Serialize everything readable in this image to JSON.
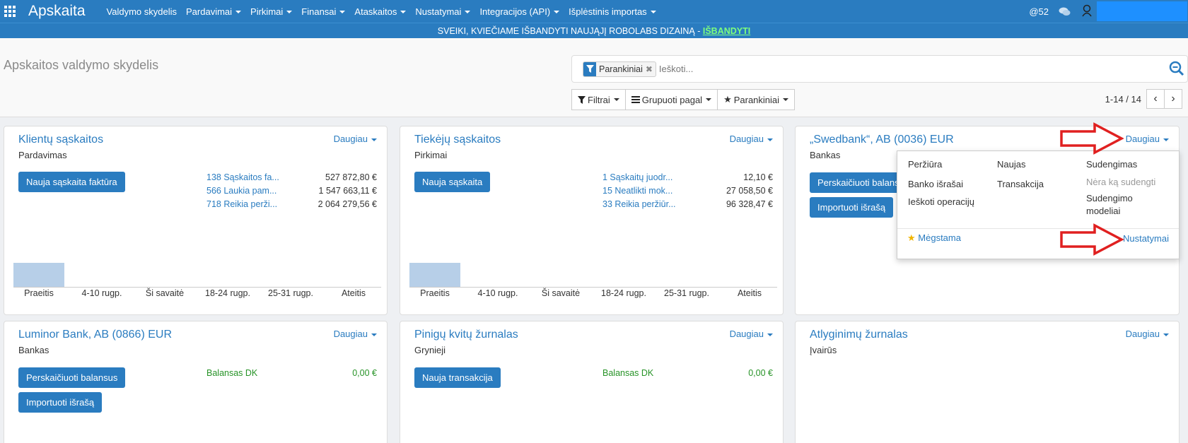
{
  "app": {
    "brand": "Apskaita"
  },
  "menu": [
    "Valdymo skydelis",
    "Pardavimai",
    "Pirkimai",
    "Finansai",
    "Ataskaitos",
    "Nustatymai",
    "Integracijos (API)",
    "Išplėstinis importas"
  ],
  "menu_has_caret": [
    false,
    true,
    true,
    true,
    true,
    true,
    true,
    true
  ],
  "topbar": {
    "at_count": "52",
    "at_prefix": "@"
  },
  "banner": {
    "text": "SVEIKI, KVIEČIAME IŠBANDYTI NAUJĄJĮ ROBOLABS DIZAINĄ - ",
    "link": "IŠBANDYTI"
  },
  "page": {
    "title": "Apskaitos valdymo skydelis"
  },
  "search": {
    "facet": "Parankiniai",
    "placeholder": "Ieškoti..."
  },
  "buttons": {
    "filters": "Filtrai",
    "group_by": "Grupuoti pagal",
    "favorites": "Parankiniai"
  },
  "pager": {
    "value": "1-14 / 14"
  },
  "cards": [
    {
      "title": "Klientų sąskaitos",
      "subtitle": "Pardavimas",
      "more": "Daugiau",
      "button": "Nauja sąskaita faktūra",
      "stats": [
        {
          "label": "138 Sąskaitos fa...",
          "value": "527 872,80 €"
        },
        {
          "label": "566 Laukia pam...",
          "value": "1 547 663,11 €"
        },
        {
          "label": "718 Reikia perži...",
          "value": "2 064 279,56 €"
        }
      ]
    },
    {
      "title": "Tiekėjų sąskaitos",
      "subtitle": "Pirkimai",
      "more": "Daugiau",
      "button": "Nauja sąskaita",
      "stats": [
        {
          "label": "1 Sąskaitų juodr...",
          "value": "12,10 €"
        },
        {
          "label": "15 Neatlikti mok...",
          "value": "27 058,50 €"
        },
        {
          "label": "33 Reikia peržiūr...",
          "value": "96 328,47 €"
        }
      ]
    },
    {
      "title": "„Swedbank“, AB (0036) EUR",
      "subtitle": "Bankas",
      "more": "Daugiau",
      "button1": "Perskaičiuoti balansą",
      "button2": "Importuoti išrašą"
    },
    {
      "title": "Luminor Bank, AB (0866) EUR",
      "subtitle": "Bankas",
      "more": "Daugiau",
      "button1": "Perskaičiuoti balansus",
      "button2": "Importuoti išrašą",
      "stat_label": "Balansas DK",
      "stat_value": "0,00 €"
    },
    {
      "title": "Pinigų kvitų žurnalas",
      "subtitle": "Grynieji",
      "more": "Daugiau",
      "button": "Nauja transakcija",
      "stat_label": "Balansas DK",
      "stat_value": "0,00 €"
    },
    {
      "title": "Atlyginimų žurnalas",
      "subtitle": "Įvairūs",
      "more": "Daugiau"
    }
  ],
  "chart_labels": [
    "Praeitis",
    "4-10 rugp.",
    "Ši savaitė",
    "18-24 rugp.",
    "25-31 rugp.",
    "Ateitis"
  ],
  "dropdown": {
    "col1": [
      "Peržiūra",
      "Banko išrašai",
      "Ieškoti operacijų"
    ],
    "col2": [
      "Naujas",
      "Transakcija"
    ],
    "col3": [
      "Sudengimas",
      "Nėra ką sudengti",
      "Sudengimo modeliai"
    ],
    "favorite": "Mėgstama",
    "settings": "Nustatymai"
  },
  "colors": {
    "brand_blue": "#2a7cc0",
    "banner_link": "#7dff7d",
    "balance_green": "#279327",
    "arrow_red": "#e02020"
  }
}
